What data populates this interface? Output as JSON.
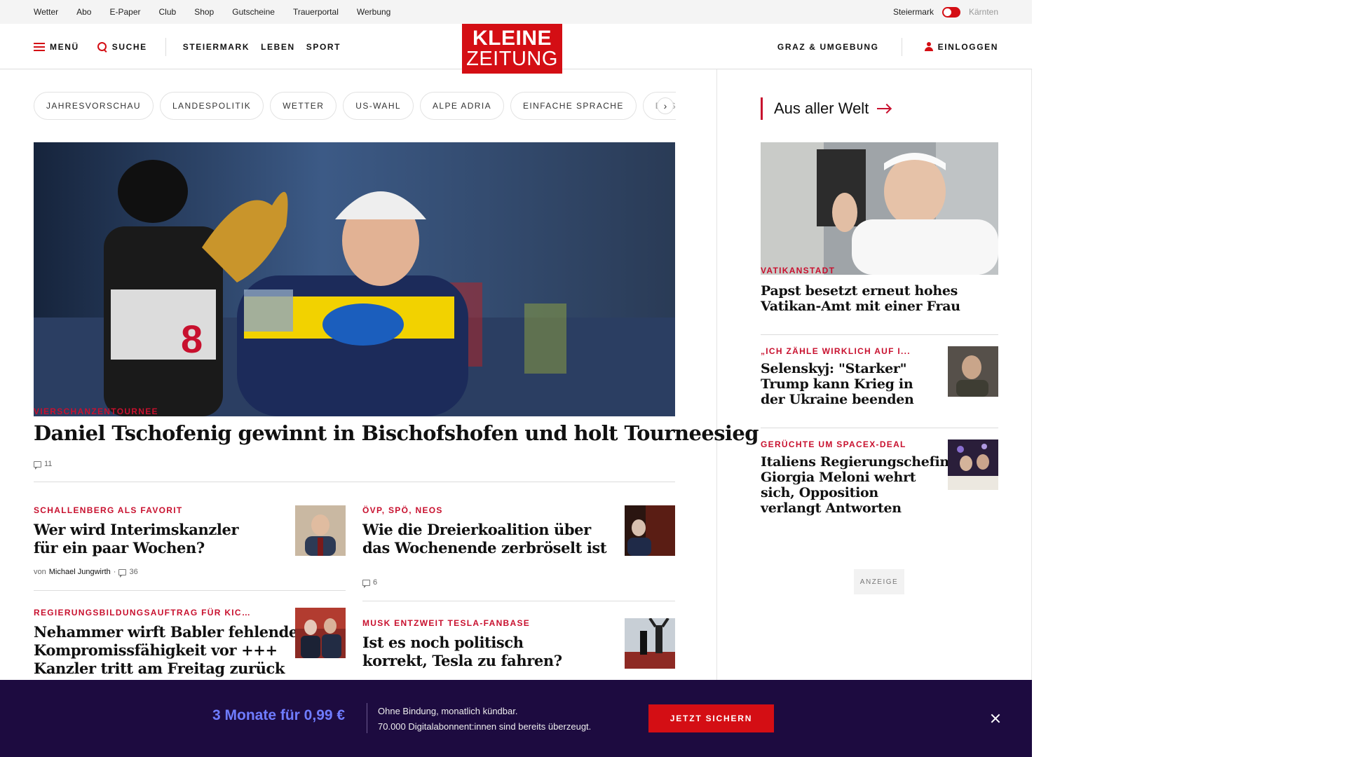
{
  "topbar": {
    "links": [
      "Wetter",
      "Abo",
      "E-Paper",
      "Club",
      "Shop",
      "Gutscheine",
      "Trauerportal",
      "Werbung"
    ],
    "region_active": "Steiermark",
    "region_inactive": "Kärnten"
  },
  "header": {
    "menu_label": "MENÜ",
    "search_label": "SUCHE",
    "nav": [
      "STEIERMARK",
      "LEBEN",
      "SPORT"
    ],
    "logo_line1": "KLEINE",
    "logo_line2": "ZEITUNG",
    "local_label": "GRAZ & UMGEBUNG",
    "login_label": "EINLOGGEN"
  },
  "chips": [
    "JAHRESVORSCHAU",
    "LANDESPOLITIK",
    "WETTER",
    "US-WAHL",
    "ALPE ADRIA",
    "EINFACHE SPRACHE",
    "DOS"
  ],
  "hero": {
    "kicker": "VIERSCHANZENTOURNEE",
    "title": "Daniel Tschofenig gewinnt in Bischofshofen und holt Tourneesieg",
    "comments": "11"
  },
  "teasers": [
    {
      "kicker": "SCHALLENBERG ALS FAVORIT",
      "title_line1": "Wer wird Interimskanzler",
      "title_line2": "für ein paar Wochen?",
      "byline_prefix": "von",
      "author": "Michael Jungwirth",
      "comments": "36"
    },
    {
      "kicker": "ÖVP, SPÖ, NEOS",
      "title_line1": "Wie die Dreierkoalition über",
      "title_line2": "das Wochenende zerbröselt ist",
      "comments": "6"
    },
    {
      "kicker": "REGIERUNGSBILDUNGSAUFTRAG FÜR KIC...",
      "title_line1": "Nehammer wirft Babler fehlende",
      "title_line2": "Kompromissfähigkeit vor +++",
      "title_line3": "Kanzler tritt am Freitag zurück"
    },
    {
      "kicker": "MUSK ENTZWEIT TESLA-FANBASE",
      "title_line1": "Ist es noch politisch",
      "title_line2": "korrekt, Tesla zu fahren?"
    }
  ],
  "aside": {
    "title": "Aus aller Welt",
    "items": [
      {
        "kicker": "VATIKANSTADT",
        "title_line1": "Papst besetzt erneut hohes",
        "title_line2": "Vatikan-Amt mit einer Frau"
      },
      {
        "kicker": "„ICH ZÄHLE WIRKLICH AUF I...",
        "title_line1": "Selenskyj: \"Starker\"",
        "title_line2": "Trump kann Krieg in",
        "title_line3": "der Ukraine beenden"
      },
      {
        "kicker": "GERÜCHTE UM SPACEX-DEAL",
        "title_line1": "Italiens Regierungschefin",
        "title_line2": "Giorgia Meloni wehrt",
        "title_line3": "sich, Opposition",
        "title_line4": "verlangt Antworten"
      }
    ],
    "ad_label": "ANZEIGE"
  },
  "promo": {
    "headline": "3 Monate für 0,99 €",
    "line1": "Ohne Bindung, monatlich kündbar.",
    "line2": "70.000 Digitalabonnent:innen sind bereits überzeugt.",
    "cta": "JETZT SICHERN"
  },
  "colors": {
    "brand_red": "#d40e14",
    "kicker_red": "#c8102e",
    "promo_bg": "#1d0b40",
    "promo_accent": "#6f7cff"
  }
}
